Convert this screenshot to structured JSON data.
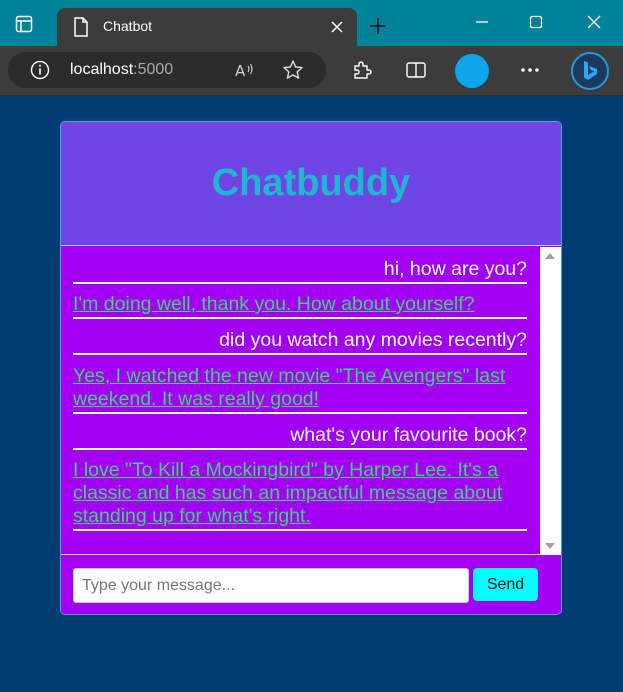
{
  "browser": {
    "tab_title": "Chatbot",
    "url_host": "localhost",
    "url_port": ":5000",
    "icons": [
      "sidebar-icon",
      "page-icon",
      "close-icon",
      "plus-icon",
      "minimize-icon",
      "maximize-icon",
      "close-window-icon",
      "info-icon",
      "read-aloud-icon",
      "favorite-star-icon",
      "extensions-icon",
      "split-screen-icon",
      "more-icon",
      "bing-icon"
    ],
    "colors": {
      "tabbar": "#008299",
      "chrome": "#3b3b3b",
      "profile": "#0ea5e9"
    }
  },
  "chat": {
    "title": "Chatbuddy",
    "messages": [
      {
        "role": "user",
        "text": "hi, how are you?"
      },
      {
        "role": "bot",
        "text": "I'm doing well, thank you. How about yourself?"
      },
      {
        "role": "user",
        "text": "did you watch any movies recently?"
      },
      {
        "role": "bot",
        "text": "Yes, I watched the new movie \"The Avengers\" last weekend. It was really good!"
      },
      {
        "role": "user",
        "text": "what's your favourite book?"
      },
      {
        "role": "bot",
        "text": "I love \"To Kill a Mockingbird\" by Harper Lee. It's a classic and has such an impactful message about standing up for what's right."
      }
    ],
    "input_placeholder": "Type your message...",
    "input_value": "",
    "send_label": "Send",
    "colors": {
      "page_bg": "#003b73",
      "header_bg": "#7045e6",
      "title": "#1fb7cf",
      "panel_bg": "#a100f2",
      "user_text": "#ffffff",
      "bot_text": "#43d17a",
      "send_bg": "#00ffff"
    }
  }
}
